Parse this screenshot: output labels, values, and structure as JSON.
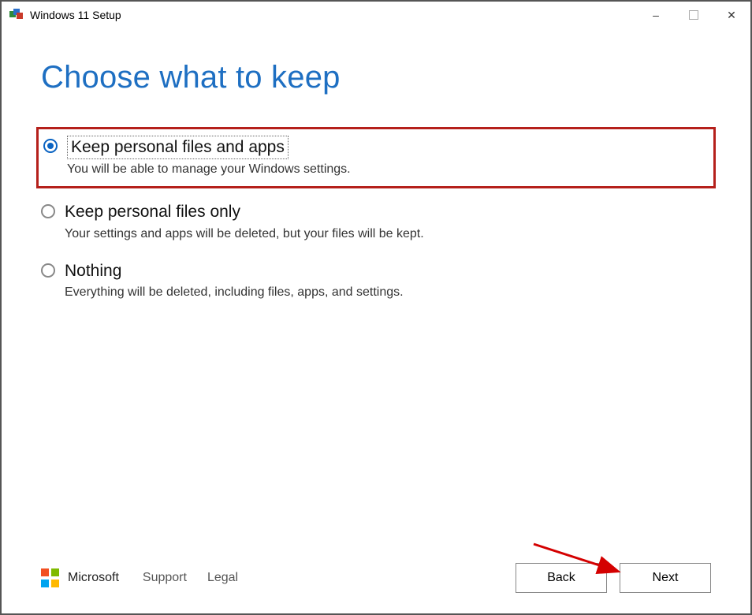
{
  "window": {
    "title": "Windows 11 Setup"
  },
  "page": {
    "heading": "Choose what to keep"
  },
  "options": [
    {
      "label": "Keep personal files and apps",
      "description": "You will be able to manage your Windows settings.",
      "selected": true,
      "highlighted": true
    },
    {
      "label": "Keep personal files only",
      "description": "Your settings and apps will be deleted, but your files will be kept.",
      "selected": false,
      "highlighted": false
    },
    {
      "label": "Nothing",
      "description": "Everything will be deleted, including files, apps, and settings.",
      "selected": false,
      "highlighted": false
    }
  ],
  "footer": {
    "brand": "Microsoft",
    "support_label": "Support",
    "legal_label": "Legal",
    "back_label": "Back",
    "next_label": "Next"
  },
  "annotation": {
    "highlight_color": "#b5201b",
    "arrow_color": "#d40000"
  }
}
